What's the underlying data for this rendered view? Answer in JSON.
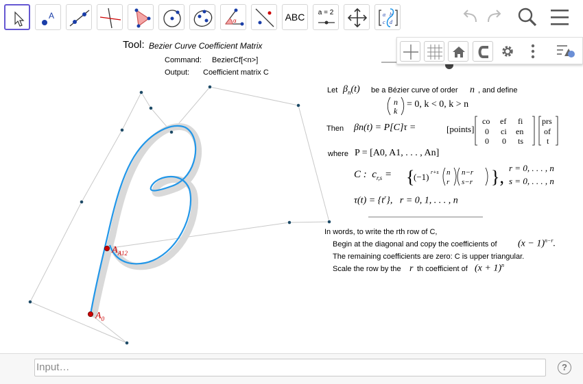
{
  "toolbar": {
    "tools": [
      "move-tool",
      "point-tool",
      "line-tool",
      "perpendicular-line-tool",
      "polygon-tool",
      "circle-tool",
      "conic-tool",
      "angle-tool",
      "reflect-tool",
      "text-tool",
      "slider-tool",
      "move-graphics-view-tool",
      "custom-tool"
    ],
    "text_tool_label": "ABC",
    "slider_tool_label": "a = 2"
  },
  "graphics_style_bar": {
    "buttons": [
      "axes-toggle",
      "grid-toggle",
      "standard-view",
      "point-capturing",
      "graphics-settings",
      "more-options",
      "toggle-style-bar"
    ]
  },
  "tool_info": {
    "tool_prefix": "Tool:",
    "tool_name": "Bezier Curve Coefficient Matrix",
    "command_label": "Command:",
    "command_value": "BezierCf[<n>]",
    "output_label": "Output:",
    "output_value": "Coefficient matrix C"
  },
  "explanation": {
    "let": "Let",
    "beta": "βn(t)",
    "be_a": "be a  Bézier curve of order",
    "n": "n",
    "and_define": ",  and define",
    "binom_def": "= 0,    k < 0,    k > n",
    "then": "Then",
    "then_beta": "βn(t)   =   P[C]τ   =",
    "points": "[points]",
    "matrix_c": [
      [
        "co",
        "ef",
        "fi"
      ],
      [
        "0",
        "ci",
        "en"
      ],
      [
        "0",
        "0",
        "ts"
      ]
    ],
    "matrix_p": [
      "prs",
      "of",
      "t"
    ],
    "where": "where",
    "p_def": "P = [A0, A1, . . . , An]",
    "c_label": "C :  c r,s =",
    "c_body": "(−1)^(r+s) (n r)(n−r s−r)",
    "c_ranges": [
      "r = 0, . . . , n",
      "s = 0, . . . , n"
    ],
    "tau_def": "τ(t) = {t^r},   r = 0, 1, . . . , n",
    "words_intro": "In words, to write the rth row of C,",
    "step1": "Begin at the diagonal and copy the coefficients of",
    "step1_math": "(x − 1)^(n−r).",
    "step2": "The remaining coefficients are zero: C is upper triangular.",
    "step3a": "Scale the row by the",
    "step3_r": "r",
    "step3b": "th coefficient of",
    "step3_math": "(x + 1)^n"
  },
  "points": {
    "A0": "A0",
    "A12": "A12"
  },
  "input_bar": {
    "placeholder": "Input…",
    "help": "?"
  },
  "colors": {
    "curve": "#2196e8",
    "point_red": "#cc0000",
    "label_red": "#c00000",
    "control": "#1d4a66",
    "accent": "#6557d2"
  }
}
